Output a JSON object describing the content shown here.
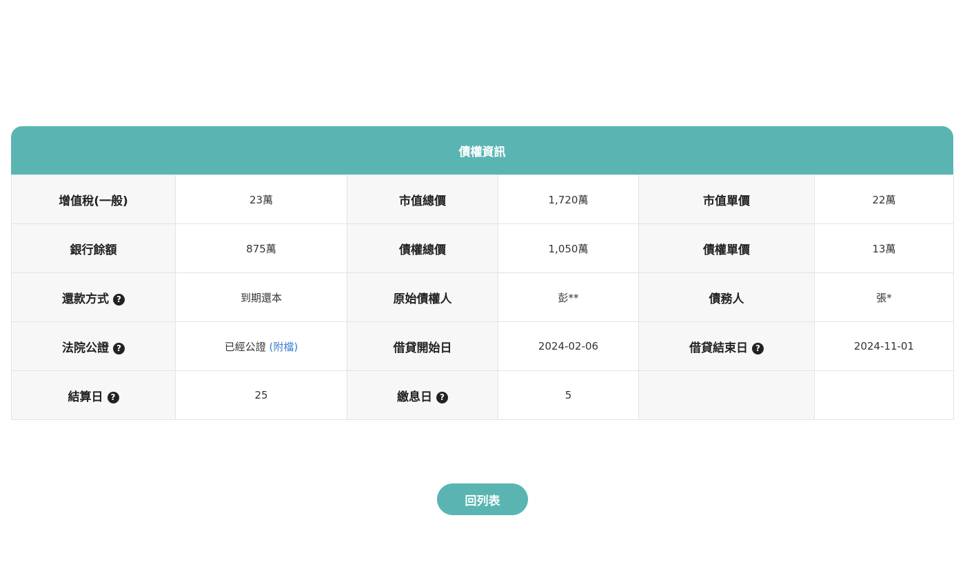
{
  "card": {
    "title": "債權資訊",
    "rows": [
      [
        {
          "label": "增值稅(一般)",
          "help": false,
          "value": "23萬"
        },
        {
          "label": "市值總價",
          "help": false,
          "value": "1,720萬"
        },
        {
          "label": "市值單價",
          "help": false,
          "value": "22萬"
        }
      ],
      [
        {
          "label": "銀行餘額",
          "help": false,
          "value": "875萬"
        },
        {
          "label": "債權總價",
          "help": false,
          "value": "1,050萬"
        },
        {
          "label": "債權單價",
          "help": false,
          "value": "13萬"
        }
      ],
      [
        {
          "label": "還款方式",
          "help": true,
          "value": "到期還本"
        },
        {
          "label": "原始債權人",
          "help": false,
          "value": "彭**"
        },
        {
          "label": "債務人",
          "help": false,
          "value": "張*"
        }
      ],
      [
        {
          "label": "法院公證",
          "help": true,
          "value": "已經公證",
          "link": "(附檔)"
        },
        {
          "label": "借貸開始日",
          "help": false,
          "value": "2024-02-06"
        },
        {
          "label": "借貸結束日",
          "help": true,
          "value": "2024-11-01"
        }
      ],
      [
        {
          "label": "結算日",
          "help": true,
          "value": "25"
        },
        {
          "label": "繳息日",
          "help": true,
          "value": "5"
        },
        {
          "label": "",
          "help": false,
          "value": ""
        }
      ]
    ]
  },
  "icons": {
    "help_glyph": "?",
    "help_icon_name": "question-circle-icon"
  },
  "colors": {
    "accent": "#5ab5b2",
    "label_bg": "#f7f7f7",
    "link": "#3a7fd0"
  },
  "back_button_label": "回列表"
}
